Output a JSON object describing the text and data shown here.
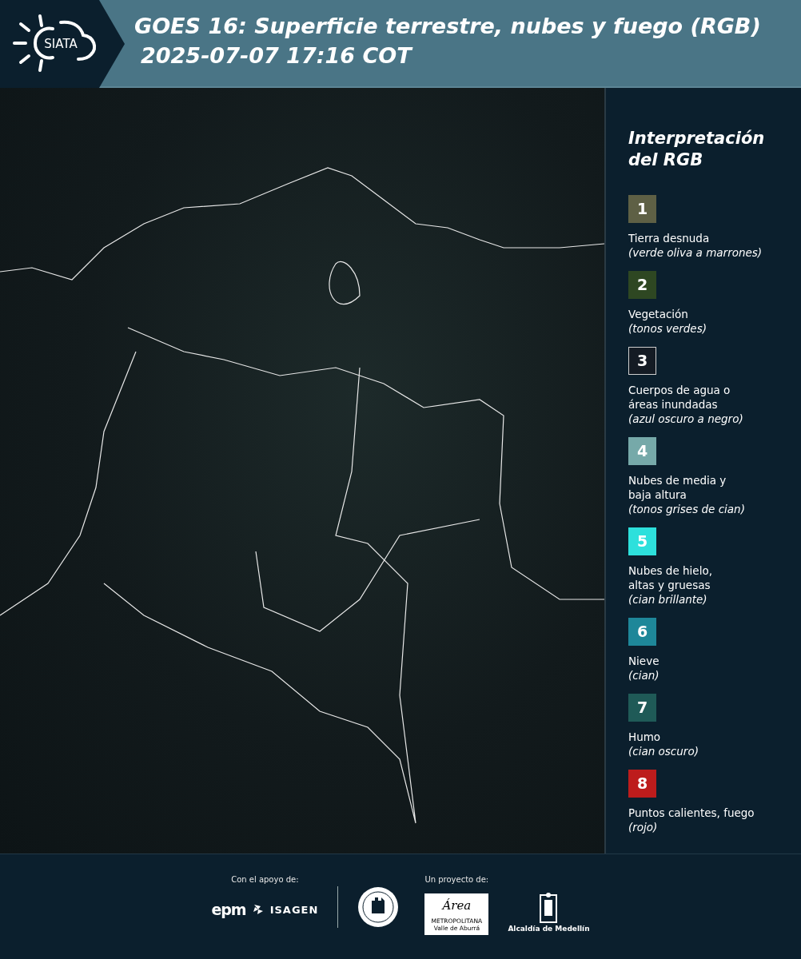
{
  "header": {
    "logo_text": "SIATA",
    "title_lines": [
      "GOES 16: Superficie terrestre, nubes y fuego (RGB)",
      "2025-07-07 17:16 COT"
    ]
  },
  "legend": {
    "title_lines": [
      "Interpretación",
      "del RGB"
    ],
    "items": [
      {
        "number": "1",
        "color": "#5e6045",
        "outlined": false,
        "lines": [
          "Tierra desnuda"
        ],
        "note": "(verde oliva a marrones)"
      },
      {
        "number": "2",
        "color": "#2e4722",
        "outlined": false,
        "lines": [
          "Vegetación"
        ],
        "note": "(tonos verdes)"
      },
      {
        "number": "3",
        "color": "#141b24",
        "outlined": true,
        "lines": [
          "Cuerpos de agua o",
          "áreas inundadas"
        ],
        "note": "(azul oscuro a negro)"
      },
      {
        "number": "4",
        "color": "#76a9a9",
        "outlined": false,
        "lines": [
          "Nubes de media y",
          "baja altura"
        ],
        "note": "(tonos grises de cian)"
      },
      {
        "number": "5",
        "color": "#2de0dc",
        "outlined": false,
        "lines": [
          "Nubes de hielo,",
          "altas y gruesas"
        ],
        "note": "(cian brillante)"
      },
      {
        "number": "6",
        "color": "#1e8799",
        "outlined": false,
        "lines": [
          "Nieve"
        ],
        "note": "(cian)"
      },
      {
        "number": "7",
        "color": "#1f5a57",
        "outlined": false,
        "lines": [
          "Humo"
        ],
        "note": "(cian oscuro)"
      },
      {
        "number": "8",
        "color": "#bd1c1c",
        "outlined": false,
        "lines": [
          "Puntos calientes, fuego"
        ],
        "note": "(rojo)"
      }
    ]
  },
  "footer": {
    "support_label": "Con el apoyo de:",
    "support_logos": [
      "epm",
      "ISAGEN"
    ],
    "project_label": "Un proyecto de:",
    "area_logo": {
      "name": "Área",
      "subtitle": "METROPOLITANA",
      "tagline": "Valle de Aburrá"
    },
    "city_logo": "Alcaldía de Medellín"
  }
}
